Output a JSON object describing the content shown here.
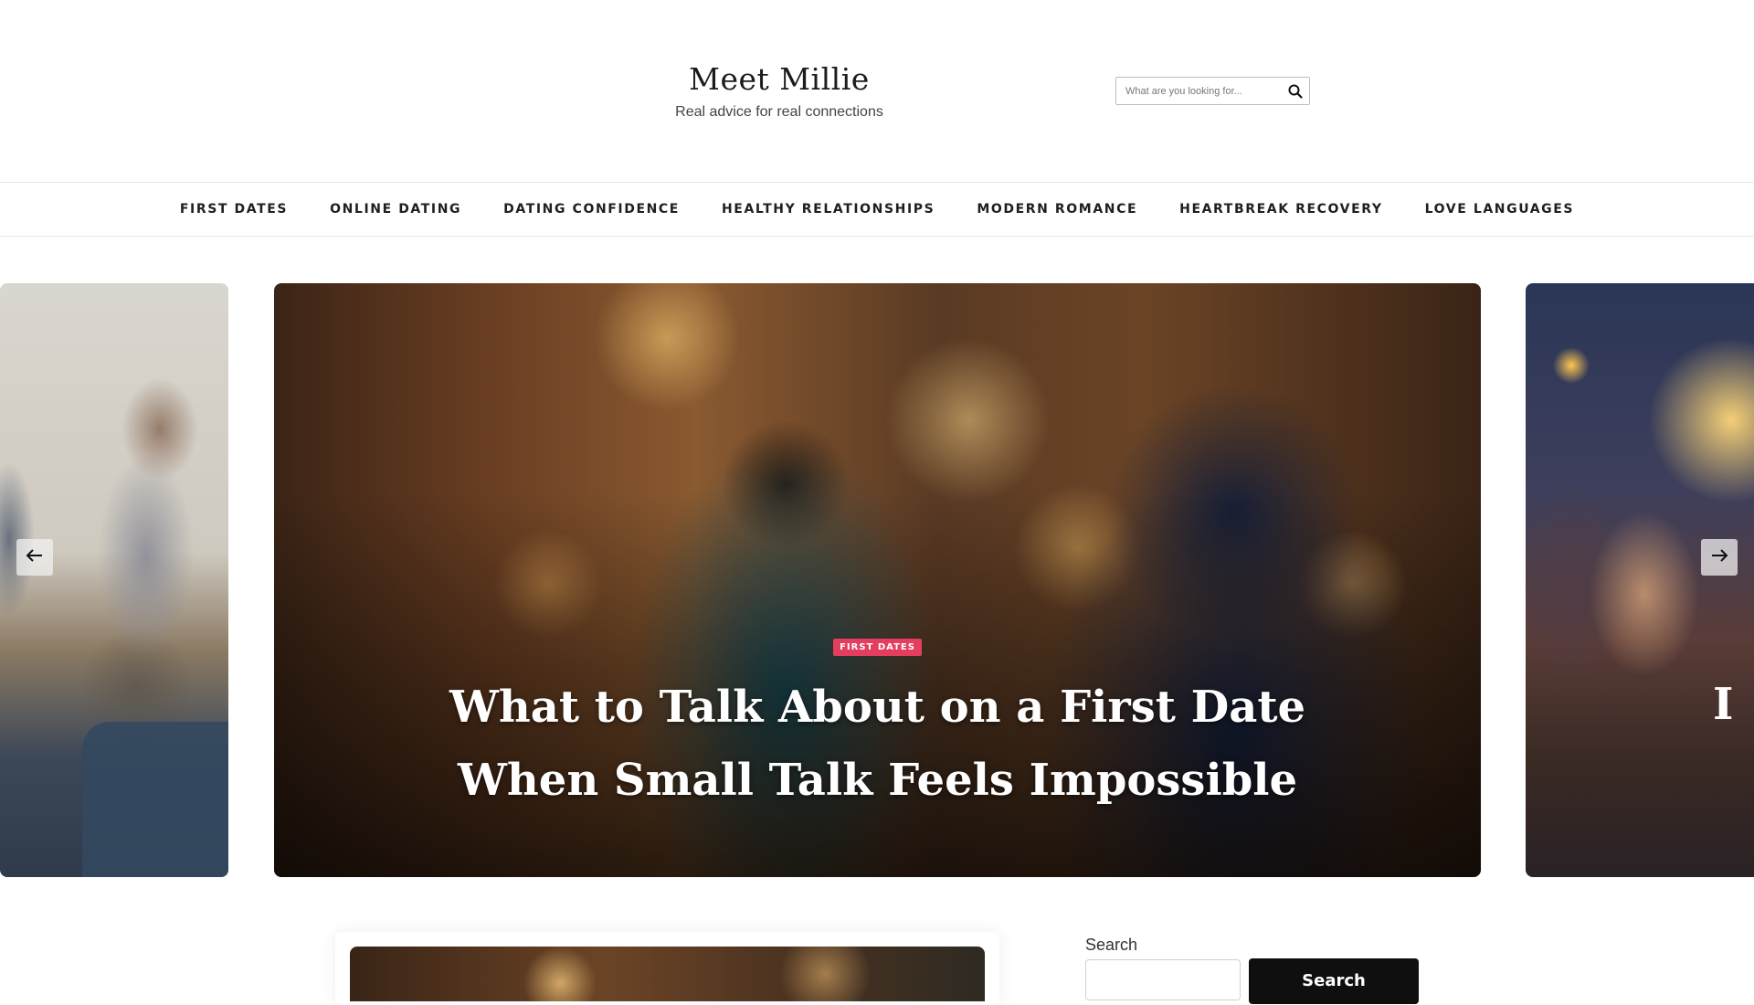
{
  "site": {
    "title": "Meet Millie",
    "tagline": "Real advice for real connections"
  },
  "header_search": {
    "placeholder": "What are you looking for...",
    "icon": "search-icon"
  },
  "nav": {
    "items": [
      {
        "label": "FIRST DATES"
      },
      {
        "label": "ONLINE DATING"
      },
      {
        "label": "DATING CONFIDENCE"
      },
      {
        "label": "HEALTHY RELATIONSHIPS"
      },
      {
        "label": "MODERN ROMANCE"
      },
      {
        "label": "HEARTBREAK RECOVERY"
      },
      {
        "label": "LOVE LANGUAGES"
      }
    ]
  },
  "slider": {
    "active_slide": {
      "category": "FIRST DATES",
      "title": "What to Talk About on a First Date When Small Talk Feels Impossible"
    },
    "next_slide_title_partial": "I",
    "prev_icon": "arrow-left-icon",
    "next_icon": "arrow-right-icon"
  },
  "sidebar": {
    "search_label": "Search",
    "search_button": "Search"
  },
  "colors": {
    "accent_badge": "#e33d5f",
    "button_dark": "#0f0f0f"
  }
}
